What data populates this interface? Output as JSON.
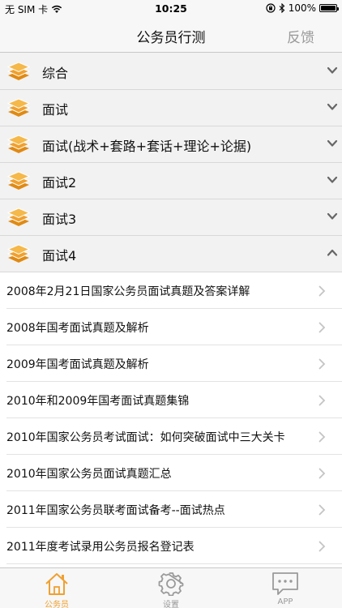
{
  "status_bar": {
    "carrier": "无 SIM 卡",
    "time": "10:25",
    "battery": "100%"
  },
  "nav": {
    "title": "公务员行测",
    "feedback": "反馈"
  },
  "sections": [
    {
      "label": "综合",
      "expanded": false
    },
    {
      "label": "面试",
      "expanded": false
    },
    {
      "label": "面试(战术+套路+套话+理论+论据)",
      "expanded": false
    },
    {
      "label": "面试2",
      "expanded": false
    },
    {
      "label": "面试3",
      "expanded": false
    },
    {
      "label": "面试4",
      "expanded": true
    }
  ],
  "items": [
    "2008年2月21日国家公务员面试真题及答案详解",
    "2008年国考面试真题及解析",
    "2009年国考面试真题及解析",
    "2010年和2009年国考面试真题集锦",
    "2010年国家公务员考试面试：如何突破面试中三大关卡",
    "2010年国家公务员面试真题汇总",
    "2011年国家公务员联考面试备考--面试热点",
    "2011年度考试录用公务员报名登记表"
  ],
  "tabs": [
    {
      "label": "公务员",
      "active": true,
      "icon": "home-icon"
    },
    {
      "label": "设置",
      "active": false,
      "icon": "gear-icon"
    },
    {
      "label": "APP",
      "active": false,
      "icon": "chat-bubble-icon"
    }
  ],
  "colors": {
    "accent": "#f0a030",
    "inactive_tab": "#9a9a9a",
    "icon_orange": "#f5a623"
  }
}
